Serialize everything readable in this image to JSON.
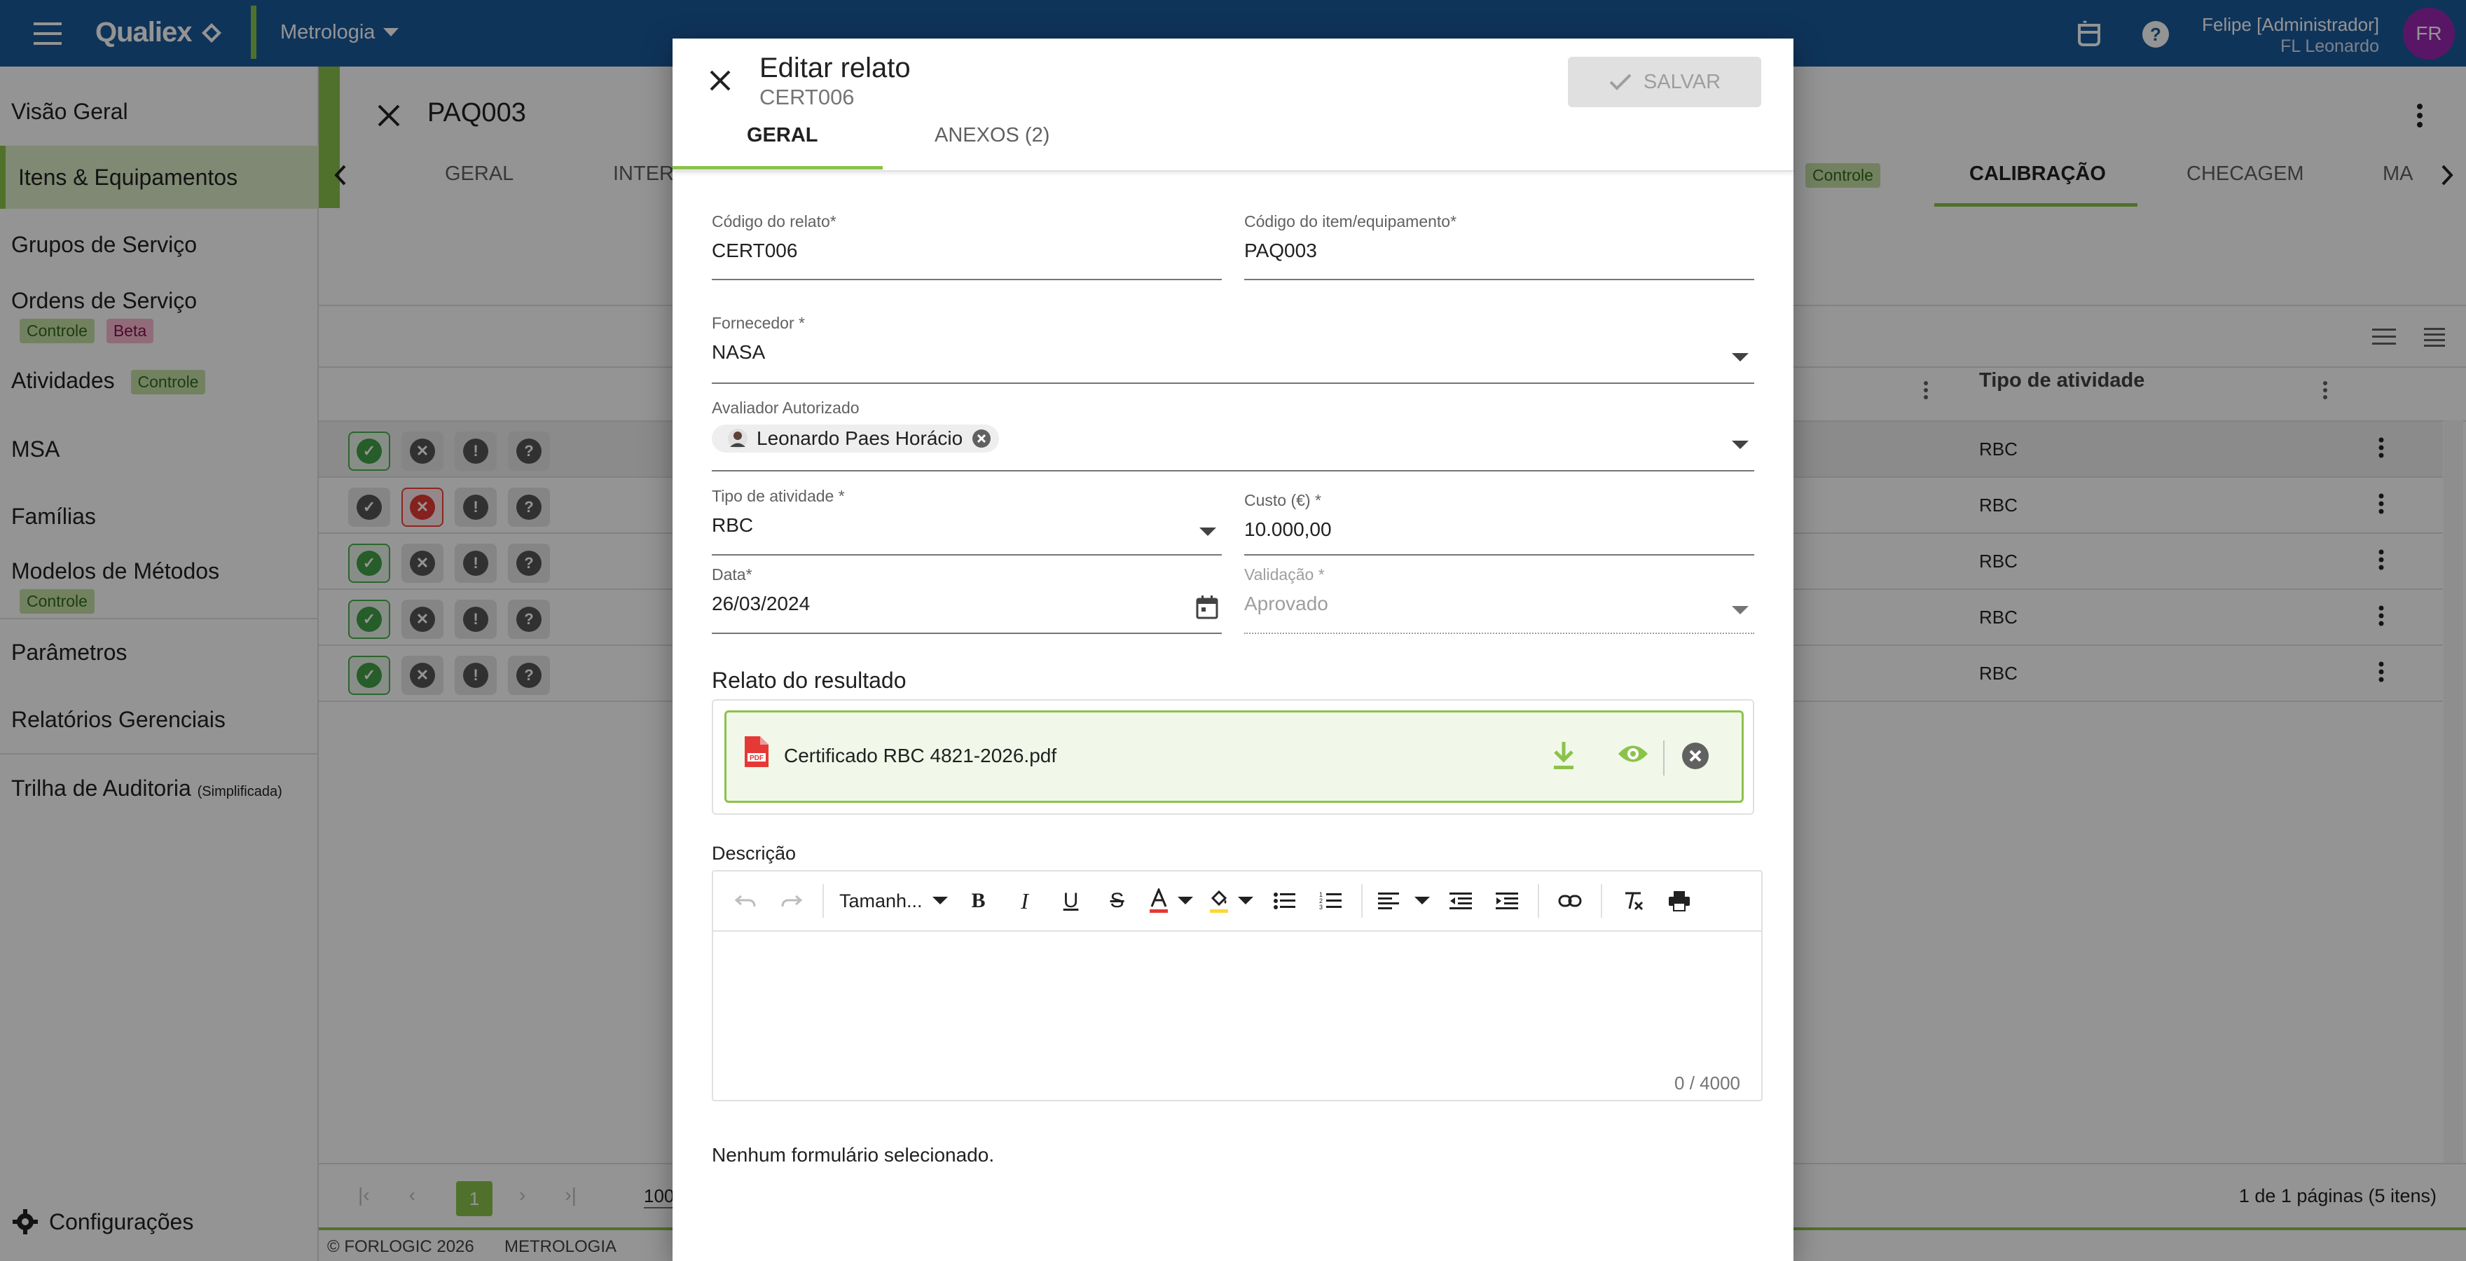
{
  "topbar": {
    "brand": "Qualiex",
    "module": "Metrologia",
    "user_name": "Felipe [Administrador]",
    "user_org": "FL Leonardo",
    "avatar_initials": "FR",
    "icons": [
      "menu-icon",
      "coffee-icon",
      "help-icon",
      "chevron-down-icon"
    ]
  },
  "sidebar": {
    "items": [
      {
        "label": "Visão Geral"
      },
      {
        "label": "Itens & Equipamentos"
      },
      {
        "label": "Grupos de Serviço"
      },
      {
        "label": "Ordens de Serviço",
        "badges": [
          "Controle",
          "Beta"
        ]
      },
      {
        "label": "Atividades",
        "badges": [
          "Controle"
        ]
      },
      {
        "label": "MSA"
      },
      {
        "label": "Famílias"
      },
      {
        "label": "Modelos de Métodos",
        "badges": [
          "Controle"
        ]
      },
      {
        "label": "Parâmetros"
      },
      {
        "label": "Relatórios Gerenciais"
      },
      {
        "label": "Trilha de Auditoria",
        "suffix": "(Simplificada)"
      }
    ],
    "config_label": "Configurações"
  },
  "main": {
    "title": "PAQ003",
    "tabs": [
      {
        "label": "GERAL"
      },
      {
        "label": "INTERV"
      },
      {
        "label": "Controle"
      },
      {
        "label": "CALIBRAÇÃO"
      },
      {
        "label": "CHECAGEM"
      },
      {
        "label": "MA"
      }
    ],
    "col_tipo": "Tipo de atividade",
    "rows": [
      {
        "tipo": "RBC"
      },
      {
        "tipo": "RBC"
      },
      {
        "tipo": "RBC"
      },
      {
        "tipo": "RBC"
      },
      {
        "tipo": "RBC"
      }
    ],
    "pager": {
      "page": "1",
      "size": "100",
      "summary": "1 de 1 páginas (5 itens)"
    },
    "footer": {
      "copyright": "© FORLOGIC 2026",
      "module": "METROLOGIA"
    }
  },
  "dialog": {
    "title": "Editar relato",
    "subtitle": "CERT006",
    "save_label": "SALVAR",
    "tabs": [
      {
        "label": "GERAL"
      },
      {
        "label": "ANEXOS (2)"
      }
    ],
    "fields": {
      "codigo_relato": {
        "label": "Código do relato*",
        "value": "CERT006"
      },
      "codigo_item": {
        "label": "Código do item/equipamento*",
        "value": "PAQ003"
      },
      "fornecedor": {
        "label": "Fornecedor *",
        "value": "NASA"
      },
      "avaliador": {
        "label": "Avaliador Autorizado",
        "chip": "Leonardo Paes Horácio"
      },
      "tipo": {
        "label": "Tipo de atividade *",
        "value": "RBC"
      },
      "custo": {
        "label": "Custo (€) *",
        "value": "10.000,00"
      },
      "data": {
        "label": "Data*",
        "value": "26/03/2024"
      },
      "validacao": {
        "label": "Validação *",
        "value": "Aprovado"
      }
    },
    "resultado": {
      "heading": "Relato do resultado",
      "file": "Certificado RBC 4821-2026.pdf"
    },
    "descricao": {
      "heading": "Descrição",
      "font_size_label": "Tamanh...",
      "counter": "0 / 4000"
    },
    "no_form": "Nenhum formulário selecionado.",
    "colors": {
      "accent": "#8bc34a",
      "header": "#1b5a9c",
      "danger": "#e53935"
    }
  }
}
